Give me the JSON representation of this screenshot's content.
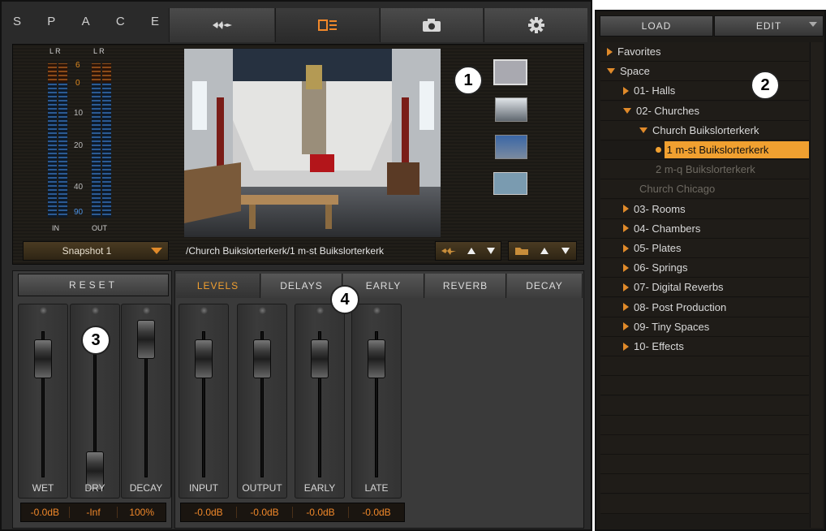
{
  "app": {
    "logo_letters": [
      "S",
      "P",
      "A",
      "C",
      "E"
    ]
  },
  "header_tabs": [
    "waveform-icon",
    "preset-display-icon",
    "camera-icon",
    "gear-icon"
  ],
  "meters": {
    "channels_top": [
      "L R",
      "L R"
    ],
    "scale": [
      "6",
      "0",
      "10",
      "20",
      "40",
      "90"
    ],
    "in_label": "IN",
    "out_label": "OUT"
  },
  "snapshot": {
    "selected": "Snapshot 1"
  },
  "preset_path": "/Church Buikslorterkerk/1 m-st Buikslorterkerk",
  "reset_label": "RESET",
  "tabs": [
    "LEVELS",
    "DELAYS",
    "EARLY",
    "REVERB",
    "DECAY"
  ],
  "left_channels": [
    {
      "label": "WET",
      "value": "-0.0dB",
      "level": 0.85
    },
    {
      "label": "DRY",
      "value": "-Inf",
      "level": 0.0
    },
    {
      "label": "DECAY",
      "value": "100%",
      "level": 1.0
    }
  ],
  "level_channels": [
    {
      "label": "INPUT",
      "value": "-0.0dB",
      "level": 0.85
    },
    {
      "label": "OUTPUT",
      "value": "-0.0dB",
      "level": 0.85
    },
    {
      "label": "EARLY",
      "value": "-0.0dB",
      "level": 0.85
    },
    {
      "label": "LATE",
      "value": "-0.0dB",
      "level": 0.85
    }
  ],
  "browser": {
    "load_label": "LOAD",
    "edit_label": "EDIT",
    "items": [
      {
        "label": "Favorites",
        "indent": 0,
        "expander": "right",
        "state": "normal"
      },
      {
        "label": "Space",
        "indent": 0,
        "expander": "down",
        "state": "normal"
      },
      {
        "label": "01- Halls",
        "indent": 1,
        "expander": "right",
        "state": "normal"
      },
      {
        "label": "02- Churches",
        "indent": 1,
        "expander": "down",
        "state": "normal"
      },
      {
        "label": "Church Buikslorterkerk",
        "indent": 2,
        "expander": "down",
        "state": "normal"
      },
      {
        "label": "1 m-st Buikslorterkerk",
        "indent": 3,
        "expander": "dot",
        "state": "selected"
      },
      {
        "label": "2 m-q Buikslorterkerk",
        "indent": 3,
        "expander": "none",
        "state": "dim"
      },
      {
        "label": "Church Chicago",
        "indent": 2,
        "expander": "none",
        "state": "dim"
      },
      {
        "label": "03- Rooms",
        "indent": 1,
        "expander": "right",
        "state": "normal"
      },
      {
        "label": "04- Chambers",
        "indent": 1,
        "expander": "right",
        "state": "normal"
      },
      {
        "label": "05- Plates",
        "indent": 1,
        "expander": "right",
        "state": "normal"
      },
      {
        "label": "06- Springs",
        "indent": 1,
        "expander": "right",
        "state": "normal"
      },
      {
        "label": "07- Digital Reverbs",
        "indent": 1,
        "expander": "right",
        "state": "normal"
      },
      {
        "label": "08- Post Production",
        "indent": 1,
        "expander": "right",
        "state": "normal"
      },
      {
        "label": "09- Tiny Spaces",
        "indent": 1,
        "expander": "right",
        "state": "normal"
      },
      {
        "label": "10- Effects",
        "indent": 1,
        "expander": "right",
        "state": "normal"
      }
    ]
  },
  "callouts": [
    "1",
    "2",
    "3",
    "4"
  ],
  "colors": {
    "accent": "#e08a2a",
    "selected_row": "#f0a030",
    "meter_blue": "#2b5a93"
  }
}
